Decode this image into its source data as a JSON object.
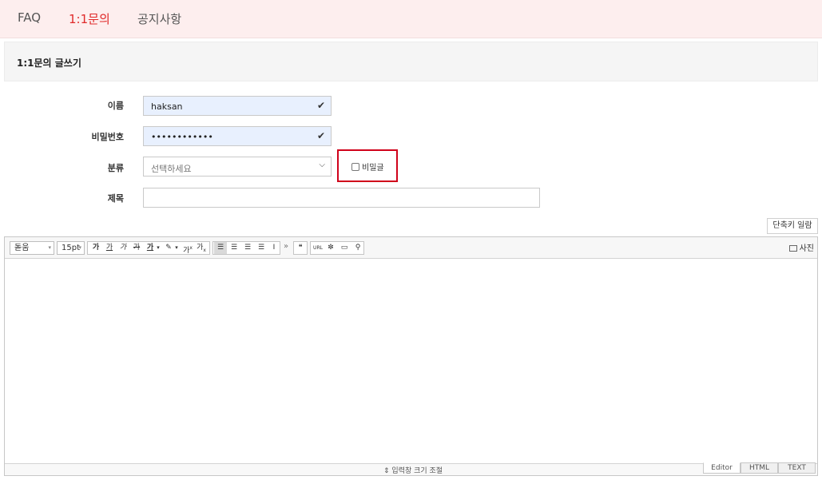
{
  "nav": {
    "tabs": [
      {
        "label": "FAQ",
        "active": false
      },
      {
        "label": "1:1문의",
        "active": true
      },
      {
        "label": "공지사항",
        "active": false
      }
    ]
  },
  "section": {
    "title": "1:1문의 글쓰기"
  },
  "form": {
    "name_label": "이름",
    "name_value": "haksan",
    "password_label": "비밀번호",
    "password_value": "••••••••••••",
    "category_label": "분류",
    "category_value": "선택하세요",
    "secret_label": "비밀글",
    "secret_checked": false,
    "subject_label": "제목",
    "subject_value": ""
  },
  "shortcut_button": "단축키 일람",
  "editor": {
    "font": "돋움",
    "size": "15pt",
    "format_buttons": [
      "가",
      "가",
      "가",
      "가",
      "가",
      "가",
      "가",
      "가"
    ],
    "photo_label": "사진",
    "resize_label": "⇕ 입력창 크기 조절",
    "modes": [
      "Editor",
      "HTML",
      "TEXT"
    ],
    "active_mode": "Editor"
  },
  "colors": {
    "accent": "#e02a2a",
    "highlight_border": "#d0021b",
    "nav_bg": "#fdeeee",
    "autofill_bg": "#e8f0fe"
  }
}
